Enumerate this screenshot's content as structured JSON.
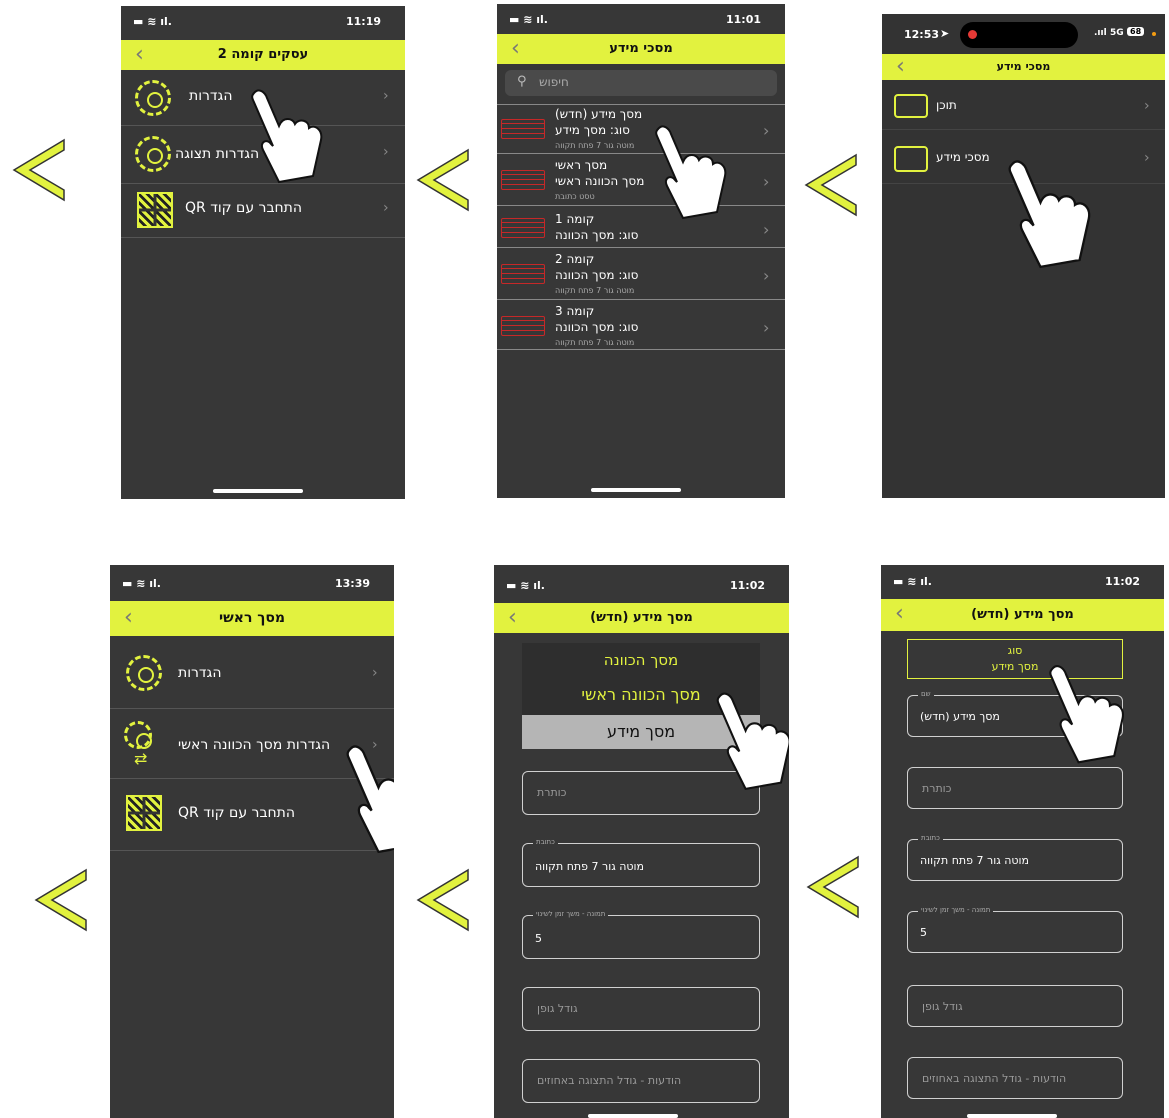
{
  "colors": {
    "accent": "#e2f23f",
    "background": "#373737",
    "nav_arrow": "#e2f23f"
  },
  "screen1": {
    "status_time": "11:19",
    "title": "עסקים קומה 2",
    "items": [
      {
        "label": "הגדרות",
        "icon": "gear-icon"
      },
      {
        "label": "הגדרות תצוגה",
        "icon": "gear-icon"
      },
      {
        "label": "התחבר עם קוד QR",
        "icon": "qr-code-icon"
      }
    ]
  },
  "screen2": {
    "status_time": "11:01",
    "title": "מסכי מידע",
    "search_placeholder": "חיפוש",
    "items": [
      {
        "line1": "מסך מידע (חדש)",
        "line2": "סוג: מסך מידע",
        "line3": "מוטה גור 7 פתח תקווה"
      },
      {
        "line1": "מסך ראשי",
        "line2": "מסך הכוונה ראשי",
        "line3": "טסט כתובת"
      },
      {
        "line1": "קומה 1",
        "line2": "סוג: מסך הכוונה",
        "line3": ""
      },
      {
        "line1": "קומה 2",
        "line2": "סוג: מסך הכוונה",
        "line3": "מוטה גור 7 פתח תקווה"
      },
      {
        "line1": "קומה 3",
        "line2": "סוג: מסך הכוונה",
        "line3": "מוטה גור 7 פתח תקווה"
      }
    ]
  },
  "screen3": {
    "status_time": "12:53",
    "status_network": "5G",
    "status_battery": "68",
    "title": "מסכי מידע",
    "items": [
      {
        "label": "תוכן",
        "icon": "content-icon"
      },
      {
        "label": "מסכי מידע",
        "icon": "screens-icon"
      }
    ]
  },
  "screen4": {
    "status_time": "13:39",
    "title": "מסך ראשי",
    "items": [
      {
        "label": "הגדרות",
        "icon": "gear-icon"
      },
      {
        "label": "הגדרות מסך הכוונה ראשי",
        "icon": "gear-arrows-icon"
      },
      {
        "label": "התחבר עם קוד QR",
        "icon": "qr-code-icon"
      }
    ]
  },
  "screen5": {
    "status_time": "11:02",
    "title": "מסך מידע (חדש)",
    "picker_options": [
      "מסך הכוונה",
      "מסך הכוונה ראשי",
      "מסך מידע"
    ],
    "fields": [
      {
        "legend": "",
        "label": "כותרת",
        "value": ""
      },
      {
        "legend": "כתובת",
        "label": "",
        "value": "מוטה גור 7 פתח תקווה"
      },
      {
        "legend": "תמונה - משך זמן לשינוי",
        "label": "",
        "value": "5"
      },
      {
        "legend": "",
        "label": "גודל גופן",
        "value": ""
      },
      {
        "legend": "",
        "label": "הודעות - גודל התצוגה באחוזים",
        "value": ""
      }
    ]
  },
  "screen6": {
    "status_time": "11:02",
    "title": "מסך מידע (חדש)",
    "type_label": "סוג",
    "type_value": "מסך מידע",
    "fields": [
      {
        "legend": "שם",
        "label": "",
        "value": "מסך מידע (חדש)"
      },
      {
        "legend": "",
        "label": "כותרת",
        "value": ""
      },
      {
        "legend": "כתובת",
        "label": "",
        "value": "מוטה גור 7 פתח תקווה"
      },
      {
        "legend": "תמונה - משך זמן לשינוי",
        "label": "",
        "value": "5"
      },
      {
        "legend": "",
        "label": "גודל גופן",
        "value": ""
      },
      {
        "legend": "",
        "label": "הודעות - גודל התצוגה באחוזים",
        "value": ""
      }
    ]
  }
}
